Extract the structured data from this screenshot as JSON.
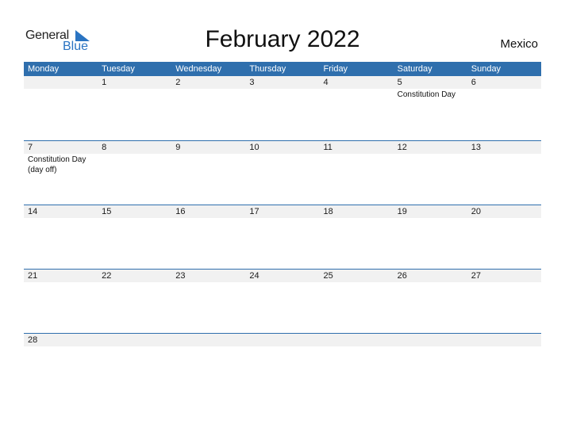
{
  "logo": {
    "general": "General",
    "blue": "Blue"
  },
  "title": "February 2022",
  "country": "Mexico",
  "colors": {
    "header": "#2f6fad",
    "accent": "#2a74c2",
    "datebar": "#f1f1f1"
  },
  "weekdays": [
    "Monday",
    "Tuesday",
    "Wednesday",
    "Thursday",
    "Friday",
    "Saturday",
    "Sunday"
  ],
  "weeks": [
    [
      {
        "day": "",
        "event": ""
      },
      {
        "day": "1",
        "event": ""
      },
      {
        "day": "2",
        "event": ""
      },
      {
        "day": "3",
        "event": ""
      },
      {
        "day": "4",
        "event": ""
      },
      {
        "day": "5",
        "event": "Constitution Day"
      },
      {
        "day": "6",
        "event": ""
      }
    ],
    [
      {
        "day": "7",
        "event": "Constitution Day\n(day off)"
      },
      {
        "day": "8",
        "event": ""
      },
      {
        "day": "9",
        "event": ""
      },
      {
        "day": "10",
        "event": ""
      },
      {
        "day": "11",
        "event": ""
      },
      {
        "day": "12",
        "event": ""
      },
      {
        "day": "13",
        "event": ""
      }
    ],
    [
      {
        "day": "14",
        "event": ""
      },
      {
        "day": "15",
        "event": ""
      },
      {
        "day": "16",
        "event": ""
      },
      {
        "day": "17",
        "event": ""
      },
      {
        "day": "18",
        "event": ""
      },
      {
        "day": "19",
        "event": ""
      },
      {
        "day": "20",
        "event": ""
      }
    ],
    [
      {
        "day": "21",
        "event": ""
      },
      {
        "day": "22",
        "event": ""
      },
      {
        "day": "23",
        "event": ""
      },
      {
        "day": "24",
        "event": ""
      },
      {
        "day": "25",
        "event": ""
      },
      {
        "day": "26",
        "event": ""
      },
      {
        "day": "27",
        "event": ""
      }
    ],
    [
      {
        "day": "28",
        "event": ""
      },
      {
        "day": "",
        "event": ""
      },
      {
        "day": "",
        "event": ""
      },
      {
        "day": "",
        "event": ""
      },
      {
        "day": "",
        "event": ""
      },
      {
        "day": "",
        "event": ""
      },
      {
        "day": "",
        "event": ""
      }
    ]
  ]
}
